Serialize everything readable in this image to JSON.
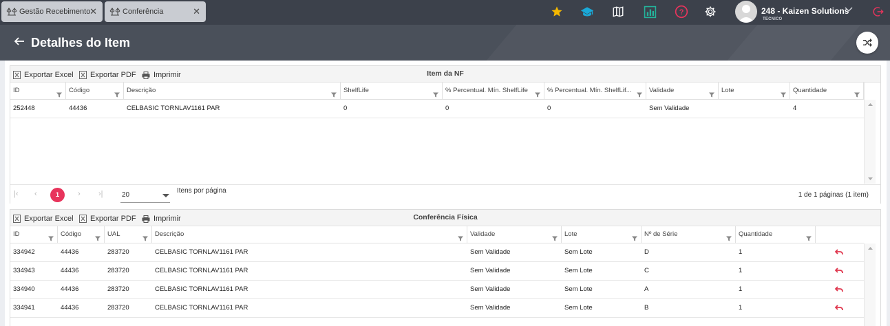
{
  "tabs": [
    {
      "label": "Gestão Recebimento"
    },
    {
      "label": "Conferência"
    }
  ],
  "topbar": {
    "icons": [
      "star-icon",
      "graduation-cap-icon",
      "map-icon",
      "chart-icon",
      "help-icon",
      "gear-icon"
    ],
    "user_name": "248 - Kaizen Solutions",
    "user_role": "TECNICO",
    "colors": {
      "star": "#f5b800",
      "cap": "#1aa9d8",
      "chart": "#24b39b",
      "help": "#e8345c",
      "logout": "#e8345c"
    }
  },
  "header": {
    "title": "Detalhes do Item"
  },
  "toolbar_labels": {
    "excel": "Exportar Excel",
    "pdf": "Exportar PDF",
    "print": "Imprimir"
  },
  "nf_grid": {
    "title": "Item da NF",
    "columns": [
      "ID",
      "Código",
      "Descrição",
      "ShelfLife",
      "% Percentual. Mín. ShelfLife",
      "% Percentual. Mín. ShelfLif...",
      "Validade",
      "Lote",
      "Quantidade"
    ],
    "rows": [
      [
        "252448",
        "44436",
        "CELBASIC TORNLAV1161 PAR",
        "0",
        "0",
        "0",
        "Sem Validade",
        "",
        "4"
      ]
    ],
    "pager": {
      "current_page": "1",
      "page_size": "20",
      "per_page_label": "Itens por página",
      "info": "1 de 1 páginas (1 item)"
    }
  },
  "fisica_grid": {
    "title": "Conferência Física",
    "columns": [
      "ID",
      "Código",
      "UAL",
      "Descrição",
      "Validade",
      "Lote",
      "Nº de Série",
      "Quantidade"
    ],
    "rows": [
      [
        "334942",
        "44436",
        "283720",
        "CELBASIC TORNLAV1161 PAR",
        "Sem Validade",
        "Sem Lote",
        "D",
        "1"
      ],
      [
        "334943",
        "44436",
        "283720",
        "CELBASIC TORNLAV1161 PAR",
        "Sem Validade",
        "Sem Lote",
        "C",
        "1"
      ],
      [
        "334940",
        "44436",
        "283720",
        "CELBASIC TORNLAV1161 PAR",
        "Sem Validade",
        "Sem Lote",
        "A",
        "1"
      ],
      [
        "334941",
        "44436",
        "283720",
        "CELBASIC TORNLAV1161 PAR",
        "Sem Validade",
        "Sem Lote",
        "B",
        "1"
      ]
    ]
  }
}
